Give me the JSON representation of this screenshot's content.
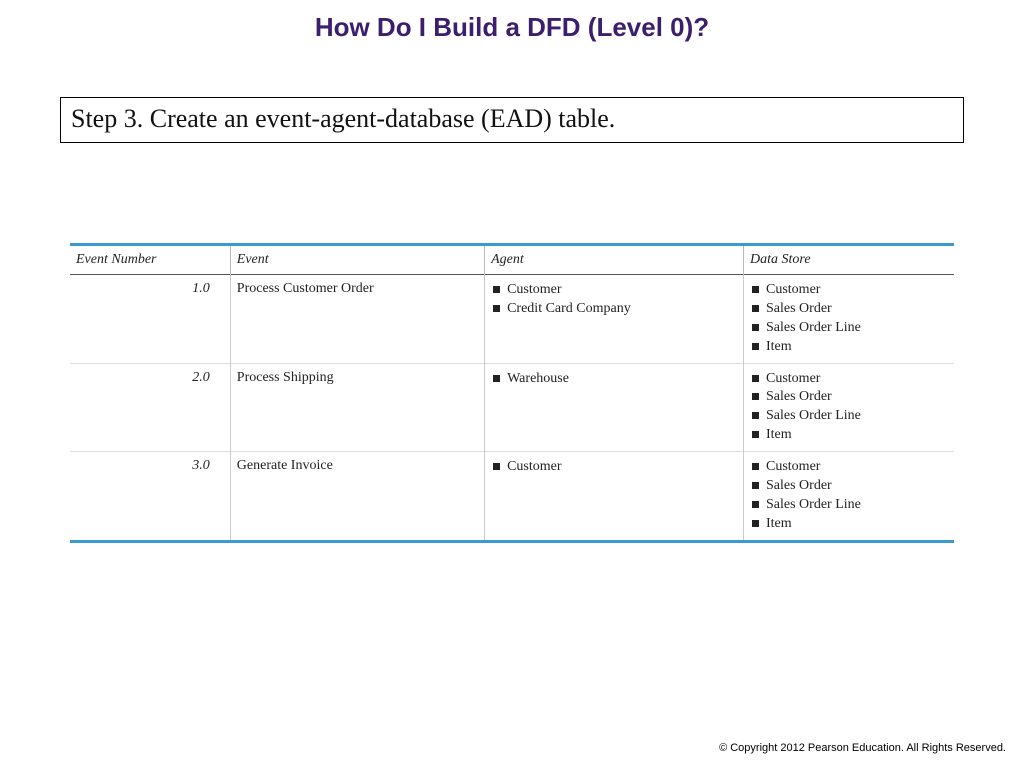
{
  "title": "How Do I Build a DFD (Level 0)?",
  "step_text": "Step 3.  Create an event-agent-database (EAD) table.",
  "table": {
    "headers": [
      "Event Number",
      "Event",
      "Agent",
      "Data Store"
    ],
    "rows": [
      {
        "event_number": "1.0",
        "event": "Process Customer Order",
        "agent": [
          "Customer",
          "Credit Card Company"
        ],
        "data_store": [
          "Customer",
          "Sales Order",
          "Sales Order Line",
          "Item"
        ]
      },
      {
        "event_number": "2.0",
        "event": "Process Shipping",
        "agent": [
          "Warehouse"
        ],
        "data_store": [
          "Customer",
          "Sales Order",
          "Sales Order Line",
          "Item"
        ]
      },
      {
        "event_number": "3.0",
        "event": "Generate Invoice",
        "agent": [
          "Customer"
        ],
        "data_store": [
          "Customer",
          "Sales Order",
          "Sales Order Line",
          "Item"
        ]
      }
    ]
  },
  "copyright": "© Copyright 2012 Pearson Education. All Rights Reserved."
}
